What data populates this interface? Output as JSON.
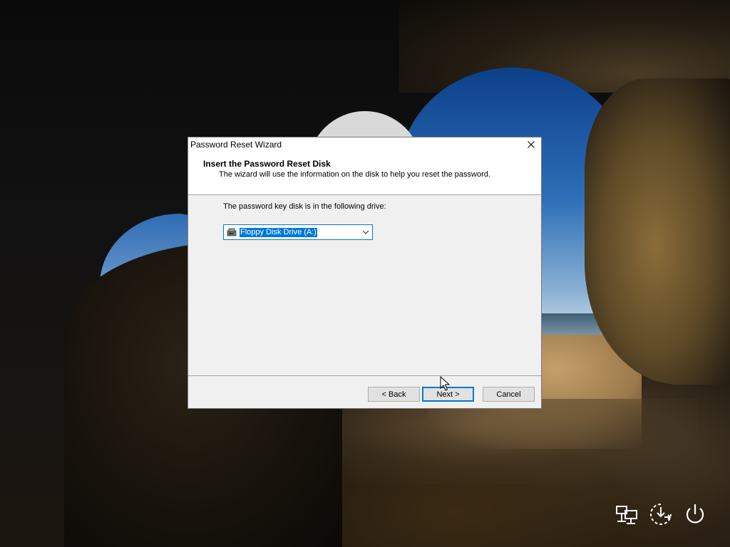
{
  "dialog": {
    "title": "Password Reset Wizard",
    "header_title": "Insert the Password Reset Disk",
    "header_subtitle": "The wizard will use the information on the disk to help you reset the password.",
    "drive_label": "The password key disk is in the following drive:",
    "drive_select": {
      "value": "Floppy Disk Drive (A:)",
      "icon": "floppy-drive-icon"
    },
    "buttons": {
      "back": "< Back",
      "next": "Next >",
      "cancel": "Cancel"
    },
    "close_icon": "close-icon"
  },
  "system_icons": [
    "network-icon",
    "ease-of-access-icon",
    "power-icon"
  ],
  "colors": {
    "accent": "#0078d7",
    "dialog_bg": "#f0f0f0",
    "header_bg": "#ffffff"
  }
}
